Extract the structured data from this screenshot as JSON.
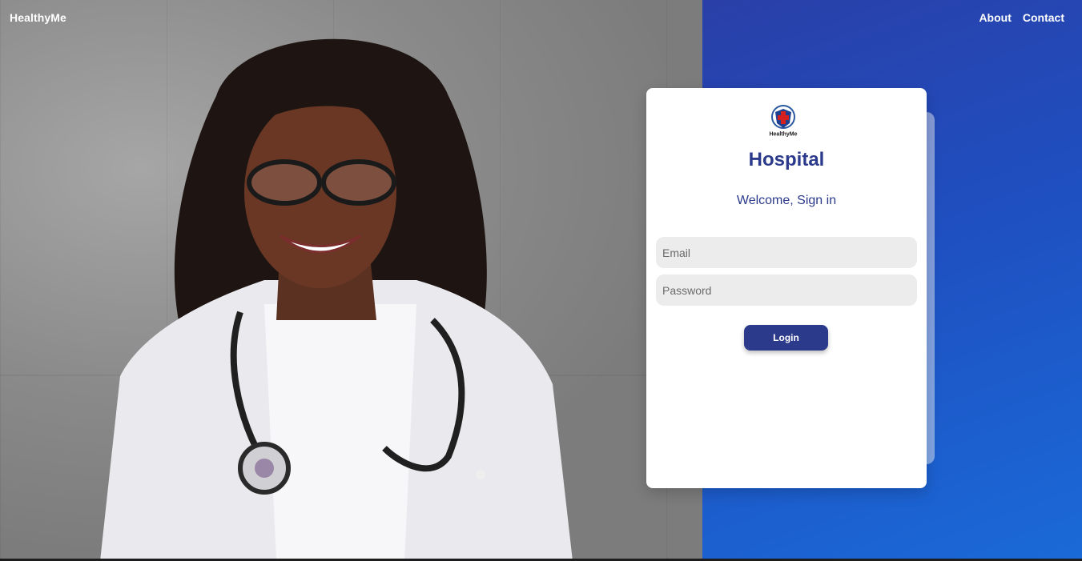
{
  "nav": {
    "brand": "HealthyMe",
    "links": [
      "About",
      "Contact"
    ]
  },
  "card": {
    "logo_text": "HealthyMe",
    "title": "Hospital",
    "subtitle": "Welcome, Sign in",
    "email_placeholder": "Email",
    "password_placeholder": "Password",
    "login_label": "Login"
  },
  "colors": {
    "brand_blue": "#2c3a8c",
    "panel_blue_start": "#2a3fa8",
    "panel_blue_end": "#1a6ad8",
    "input_bg": "#ececec"
  }
}
